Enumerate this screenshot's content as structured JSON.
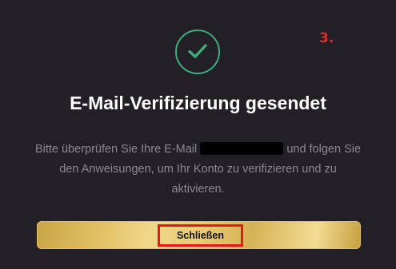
{
  "dialog": {
    "step_marker": "3.",
    "title": "E-Mail-Verifizierung gesendet",
    "message_before_email": "Bitte überprüfen Sie Ihre E-Mail",
    "message_after_email": "und folgen Sie den Anweisungen, um Ihr Konto zu verifizieren und zu aktivieren.",
    "close_button_label": "Schließen"
  },
  "icons": {
    "success": "check-circle-icon"
  },
  "colors": {
    "background": "#221f26",
    "success_green": "#3fae7c",
    "title_text": "#ffffff",
    "body_text": "#8d8894",
    "button_gold": "#e0be62",
    "annotation_red": "#e3191f"
  }
}
